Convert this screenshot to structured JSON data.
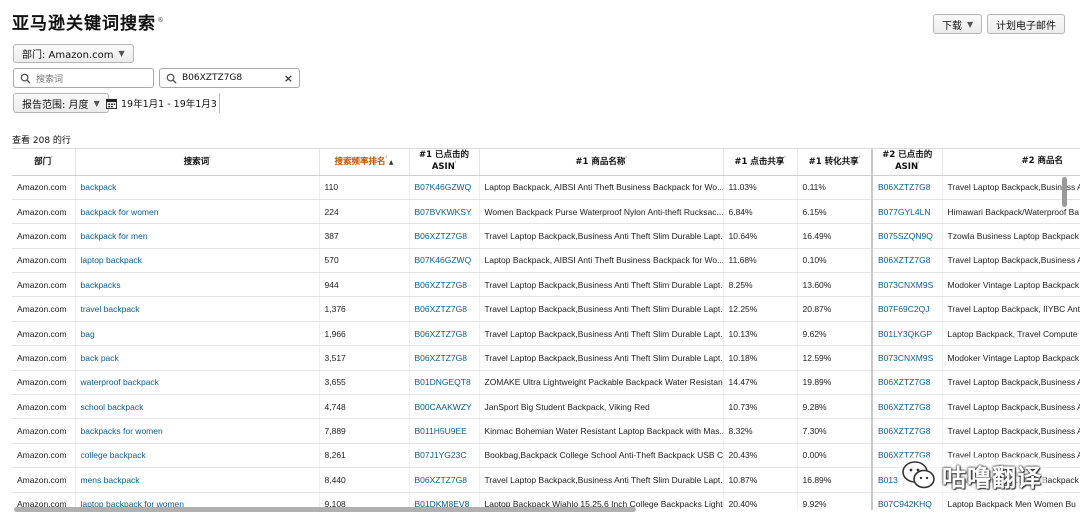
{
  "header": {
    "title": "亚马逊关键词搜索",
    "title_mark": "®"
  },
  "toolbar": {
    "download_label": "下载",
    "schedule_label": "计划电子邮件"
  },
  "filters": {
    "department_label": "部门: Amazon.com",
    "search_term_placeholder": "搜索词",
    "asin_value": "B06XZTZ7G8",
    "clear_glyph": "×",
    "report_range_label": "报告范围: 月度",
    "date_range": "19年1月1 - 19年1月3"
  },
  "results": {
    "count_label": "查看 208 的行"
  },
  "table": {
    "headers": [
      {
        "text": "部门",
        "mark": "ⁱ"
      },
      {
        "text": "搜索词",
        "mark": "ⁱ"
      },
      {
        "text": "搜索频率排名",
        "mark": "ⁱ",
        "sort": "▲"
      },
      {
        "text": "#1 已点击的\nASIN",
        "mark": "ⁱ"
      },
      {
        "text": "#1 商品名称",
        "mark": "ⁱ"
      },
      {
        "text": "#1 点击共享",
        "mark": "ⁱ"
      },
      {
        "text": "#1 转化共享",
        "mark": "ⁱ"
      },
      {
        "text": "#2 已点击的\nASIN",
        "mark": "ⁱ"
      },
      {
        "text": "#2 商品名",
        "mark": ""
      }
    ],
    "rows": [
      [
        "Amazon.com",
        "backpack",
        "110",
        "B07K46GZWQ",
        "Laptop Backpack, AIBSI Anti Theft Business Backpack for Wo...",
        "11.03%",
        "0.11%",
        "B06XZTZ7G8",
        "Travel Laptop Backpack,Business A"
      ],
      [
        "Amazon.com",
        "backpack for women",
        "224",
        "B07BVKWKSY",
        "Women Backpack Purse Waterproof Nylon Anti-theft Rucksac...",
        "6.84%",
        "6.15%",
        "B077GYL4LN",
        "Himawari Backpack/Waterproof Ba"
      ],
      [
        "Amazon.com",
        "backpack for men",
        "387",
        "B06XZTZ7G8",
        "Travel Laptop Backpack,Business Anti Theft Slim Durable Lapt...",
        "10.64%",
        "16.49%",
        "B075SZQN9Q",
        "Tzowla Business Laptop Backpack"
      ],
      [
        "Amazon.com",
        "laptop backpack",
        "570",
        "B07K46GZWQ",
        "Laptop Backpack, AIBSI Anti Theft Business Backpack for Wo...",
        "11.68%",
        "0.10%",
        "B06XZTZ7G8",
        "Travel Laptop Backpack,Business A"
      ],
      [
        "Amazon.com",
        "backpacks",
        "944",
        "B06XZTZ7G8",
        "Travel Laptop Backpack,Business Anti Theft Slim Durable Lapt...",
        "8.25%",
        "13.60%",
        "B073CNXM9S",
        "Modoker Vintage Laptop Backpack"
      ],
      [
        "Amazon.com",
        "travel backpack",
        "1,376",
        "B06XZTZ7G8",
        "Travel Laptop Backpack,Business Anti Theft Slim Durable Lapt...",
        "12.25%",
        "20.87%",
        "B07F69C2QJ",
        "Travel Laptop Backpack, IIYBC Ant"
      ],
      [
        "Amazon.com",
        "bag",
        "1,966",
        "B06XZTZ7G8",
        "Travel Laptop Backpack,Business Anti Theft Slim Durable Lapt...",
        "10.13%",
        "9.62%",
        "B01LY3QKGP",
        "Laptop Backpack, Travel Compute"
      ],
      [
        "Amazon.com",
        "back pack",
        "3,517",
        "B06XZTZ7G8",
        "Travel Laptop Backpack,Business Anti Theft Slim Durable Lapt...",
        "10.18%",
        "12.59%",
        "B073CNXM9S",
        "Modoker Vintage Laptop Backpack"
      ],
      [
        "Amazon.com",
        "waterproof backpack",
        "3,655",
        "B01DNGEQT8",
        "ZOMAKE Ultra Lightweight Packable Backpack Water Resistan...",
        "14.47%",
        "19.89%",
        "B06XZTZ7G8",
        "Travel Laptop Backpack,Business A"
      ],
      [
        "Amazon.com",
        "school backpack",
        "4,748",
        "B00CAAKWZY",
        "JanSport Big Student Backpack, Viking Red",
        "10.73%",
        "9.28%",
        "B06XZTZ7G8",
        "Travel Laptop Backpack,Business A"
      ],
      [
        "Amazon.com",
        "backpacks for women",
        "7,889",
        "B011H5U9EE",
        "Kinmac Bohemian Water Resistant Laptop Backpack with Mas...",
        "8.32%",
        "7.30%",
        "B06XZTZ7G8",
        "Travel Laptop Backpack,Business A"
      ],
      [
        "Amazon.com",
        "college backpack",
        "8,261",
        "B07J1YG23C",
        "Bookbag,Backpack College School Anti-Theft Backpack USB C...",
        "20.43%",
        "0.00%",
        "B06XZTZ7G8",
        "Travel Laptop Backpack,Business A"
      ],
      [
        "Amazon.com",
        "mens backpack",
        "8,440",
        "B06XZTZ7G8",
        "Travel Laptop Backpack,Business Anti Theft Slim Durable Lapt...",
        "10.87%",
        "16.89%",
        "B013",
        "Tzowla Business Laptop Backpack"
      ],
      [
        "Amazon.com",
        "laptop backpack for women",
        "9,108",
        "B01DKM8EV8",
        "Laptop Backpack Wiahlo 15.25.6 Inch College Backpacks Light...",
        "20.40%",
        "9.92%",
        "B07C942KHQ",
        "Laptop Backpack Men Women Bu"
      ]
    ]
  },
  "watermark": {
    "text": "咕噜翻译"
  },
  "colors": {
    "link": "#0a5e8c",
    "sort_active": "#c45500"
  }
}
